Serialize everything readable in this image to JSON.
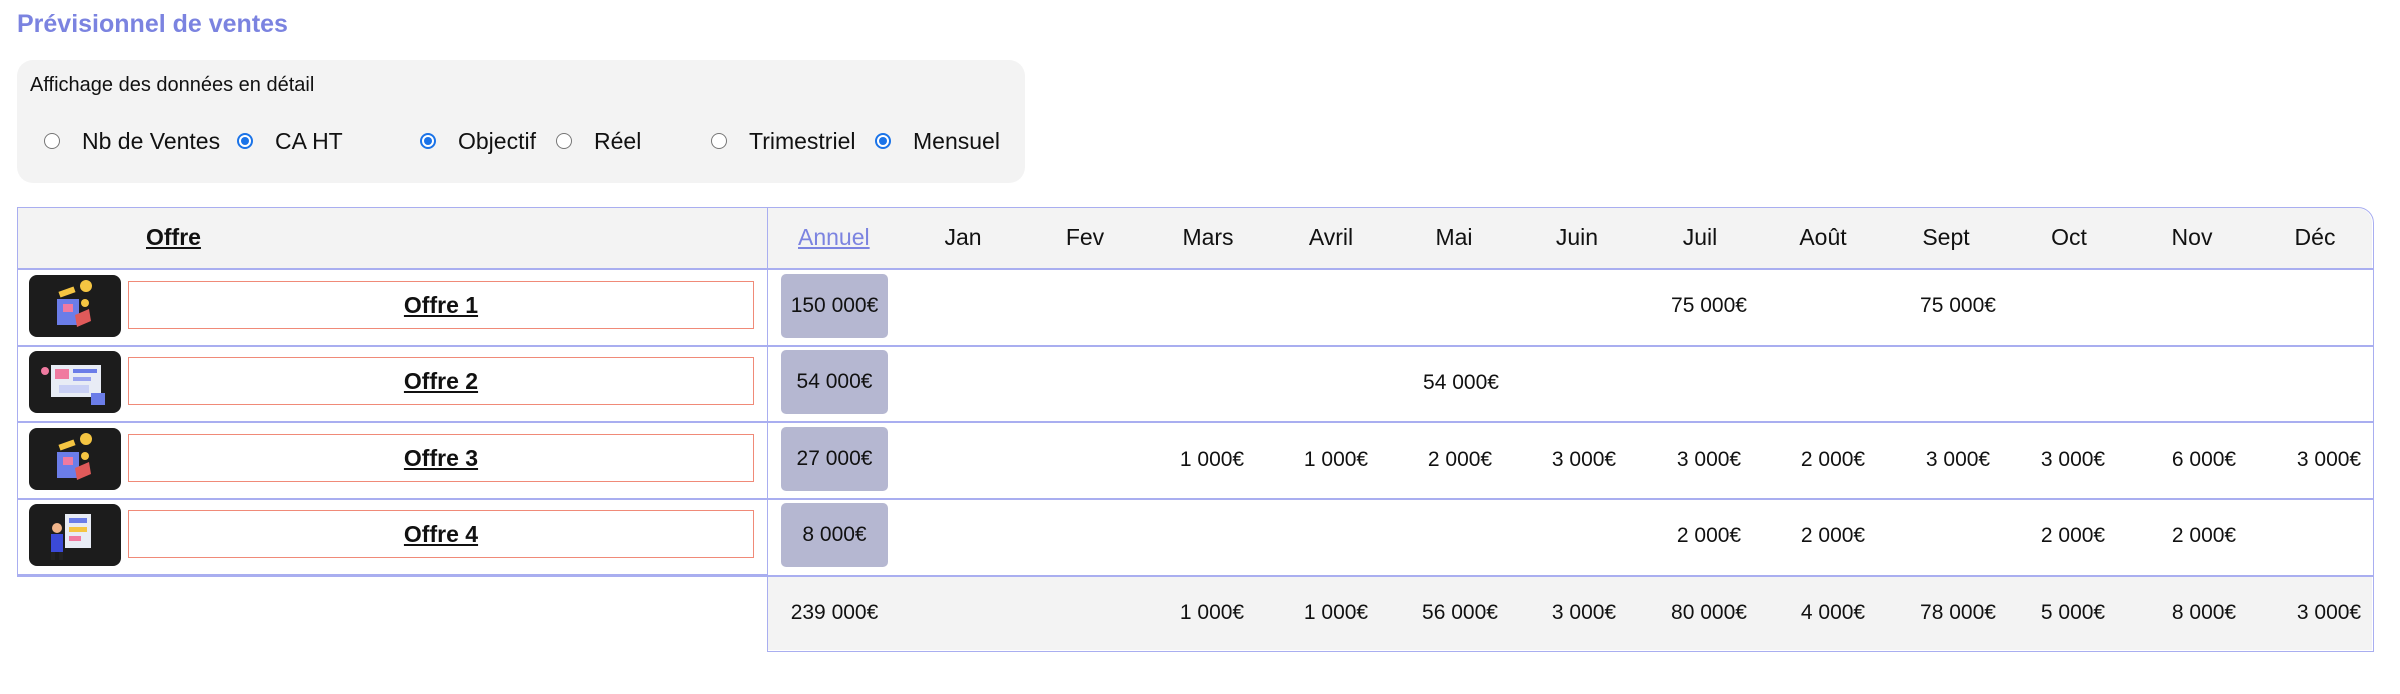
{
  "title": "Prévisionnel de ventes",
  "filters": {
    "title": "Affichage des données en détail",
    "options": [
      {
        "label": "Nb de Ventes",
        "checked": false
      },
      {
        "label": "CA HT",
        "checked": true
      },
      {
        "label": "Objectif",
        "checked": true
      },
      {
        "label": "Réel",
        "checked": false
      },
      {
        "label": "Trimestriel",
        "checked": false
      },
      {
        "label": "Mensuel",
        "checked": true
      }
    ]
  },
  "table": {
    "offre_header": "Offre",
    "annuel_header": "Annuel",
    "months": [
      "Jan",
      "Fev",
      "Mars",
      "Avril",
      "Mai",
      "Juin",
      "Juil",
      "Août",
      "Sept",
      "Oct",
      "Nov",
      "Déc"
    ],
    "rows": [
      {
        "name": "Offre 1",
        "annual": "150 000€",
        "values": [
          "",
          "",
          "",
          "",
          "",
          "",
          "75 000€",
          "",
          "75 000€",
          "",
          "",
          ""
        ]
      },
      {
        "name": "Offre 2",
        "annual": "54 000€",
        "values": [
          "",
          "",
          "",
          "",
          "54 000€",
          "",
          "",
          "",
          "",
          "",
          "",
          ""
        ]
      },
      {
        "name": "Offre 3",
        "annual": "27 000€",
        "values": [
          "",
          "",
          "1 000€",
          "1 000€",
          "2 000€",
          "3 000€",
          "3 000€",
          "2 000€",
          "3 000€",
          "3 000€",
          "6 000€",
          "3 000€"
        ]
      },
      {
        "name": "Offre 4",
        "annual": "8 000€",
        "values": [
          "",
          "",
          "",
          "",
          "",
          "",
          "2 000€",
          "2 000€",
          "",
          "2 000€",
          "2 000€",
          ""
        ]
      }
    ],
    "totals": {
      "annual": "239 000€",
      "values": [
        "",
        "",
        "1 000€",
        "1 000€",
        "56 000€",
        "3 000€",
        "80 000€",
        "4 000€",
        "78 000€",
        "5 000€",
        "8 000€",
        "3 000€"
      ]
    }
  }
}
